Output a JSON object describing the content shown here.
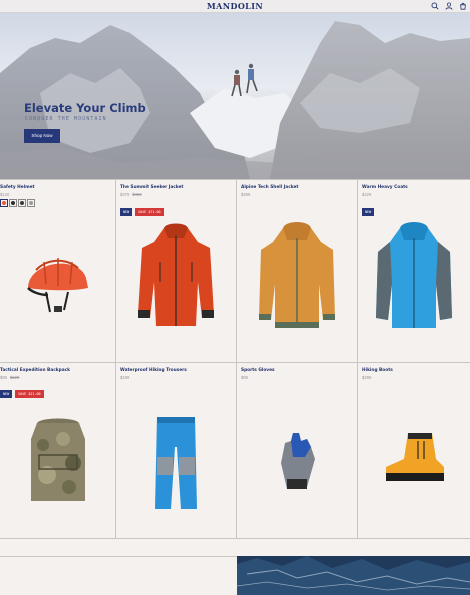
{
  "header": {
    "logo": "MANDOLIN",
    "icons": [
      "search-icon",
      "account-icon",
      "cart-icon"
    ]
  },
  "hero": {
    "title": "Elevate Your Climb",
    "subtitle": "CONQUER THE MOUNTAIN",
    "button_label": "Shop Now"
  },
  "products": [
    {
      "name": "Safety Helmet",
      "price": "$120",
      "old_price": "",
      "badges": [],
      "swatches": [
        "#e35b3a",
        "#2c2c2c",
        "#3a3a3a",
        "#9b9b9b"
      ]
    },
    {
      "name": "The Summit Seeker Jacket",
      "price": "$379",
      "old_price": "$450",
      "badges": [
        {
          "type": "new",
          "label": "NEW"
        },
        {
          "type": "save",
          "label": "SAVE $71.00"
        }
      ],
      "swatches": []
    },
    {
      "name": "Alpine Tech Shell Jacket",
      "price": "$499",
      "old_price": "",
      "badges": [],
      "swatches": []
    },
    {
      "name": "Warm Heavy Coats",
      "price": "$429",
      "old_price": "",
      "badges": [
        {
          "type": "new",
          "label": "NEW"
        }
      ],
      "swatches": []
    },
    {
      "name": "Tactical Expedition Backpack",
      "price": "$99",
      "old_price": "$120",
      "badges": [
        {
          "type": "new",
          "label": "NEW"
        },
        {
          "type": "save",
          "label": "SAVE $21.00"
        }
      ],
      "swatches": []
    },
    {
      "name": "Waterproof Hiking Trousers",
      "price": "$199",
      "old_price": "",
      "badges": [],
      "swatches": []
    },
    {
      "name": "Sports Gloves",
      "price": "$89",
      "old_price": "",
      "badges": [],
      "swatches": []
    },
    {
      "name": "Hiking Boots",
      "price": "$299",
      "old_price": "",
      "badges": [],
      "swatches": []
    }
  ],
  "colors": {
    "brand": "#23346e",
    "sale": "#d43838",
    "background": "#f4f1ee"
  }
}
